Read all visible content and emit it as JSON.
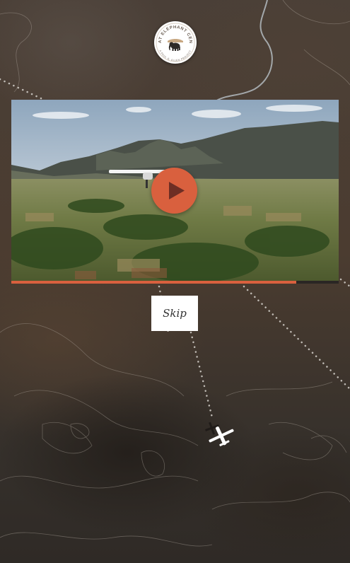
{
  "logo": {
    "arc_top": "GREAT ELEPHANT CENSUS",
    "arc_bottom": "A PAUL G. ALLEN PROJECT",
    "icon": "elephant-icon"
  },
  "video": {
    "description_icon": "play-icon",
    "progress_percent": 87
  },
  "skip": {
    "label": "Skip"
  },
  "colors": {
    "accent": "#d9603e",
    "logo_text": "#6b5e53",
    "map_dots": "#d6d2cc"
  },
  "plane": {
    "icon": "plane-icon"
  }
}
